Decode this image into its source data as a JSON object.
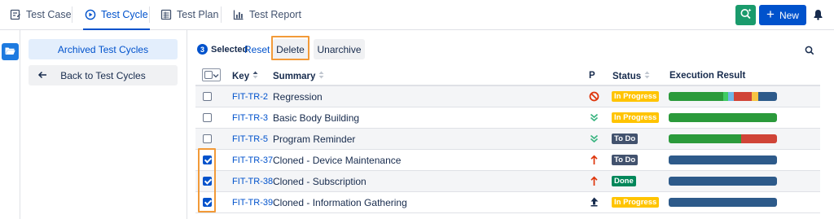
{
  "nav": {
    "tabs": [
      {
        "label": "Test Case",
        "icon": "test-case-icon"
      },
      {
        "label": "Test Cycle",
        "icon": "test-cycle-icon",
        "active": true
      },
      {
        "label": "Test Plan",
        "icon": "test-plan-icon"
      },
      {
        "label": "Test Report",
        "icon": "test-report-icon"
      }
    ],
    "new_label": "New",
    "ai_icon": "ai-search-icon",
    "bell_icon": "bell-icon"
  },
  "sidebar": {
    "archived_label": "Archived Test Cycles",
    "back_label": "Back to Test Cycles"
  },
  "toolbar": {
    "selected_count": "3",
    "selected_label": "Selected",
    "reset_label": "Reset",
    "delete_label": "Delete",
    "unarchive_label": "Unarchive"
  },
  "table": {
    "headers": {
      "key": "Key",
      "summary": "Summary",
      "priority": "P",
      "status": "Status",
      "execution": "Execution Result"
    },
    "rows": [
      {
        "key": "FIT-TR-2",
        "summary": "Regression",
        "priority": "blocker",
        "status": "In Progress",
        "checked": false,
        "execution": [
          {
            "color": "#2b9a3b",
            "pct": 50
          },
          {
            "color": "#3fcb64",
            "pct": 5
          },
          {
            "color": "#6fb6e6",
            "pct": 5
          },
          {
            "color": "#d04437",
            "pct": 17
          },
          {
            "color": "#f6c342",
            "pct": 6
          },
          {
            "color": "#2d5a8a",
            "pct": 17
          }
        ]
      },
      {
        "key": "FIT-TR-3",
        "summary": "Basic Body Building",
        "priority": "lowest",
        "status": "In Progress",
        "checked": false,
        "execution": [
          {
            "color": "#2b9a3b",
            "pct": 100
          }
        ]
      },
      {
        "key": "FIT-TR-5",
        "summary": "Program Reminder",
        "priority": "lowest",
        "status": "To Do",
        "checked": false,
        "execution": [
          {
            "color": "#2b9a3b",
            "pct": 67
          },
          {
            "color": "#d04437",
            "pct": 33
          }
        ]
      },
      {
        "key": "FIT-TR-37",
        "summary": "Cloned - Device Maintenance",
        "priority": "high",
        "status": "To Do",
        "checked": true,
        "execution": [
          {
            "color": "#2d5a8a",
            "pct": 100
          }
        ]
      },
      {
        "key": "FIT-TR-38",
        "summary": "Cloned - Subscription",
        "priority": "high",
        "status": "Done",
        "checked": true,
        "execution": [
          {
            "color": "#2d5a8a",
            "pct": 100
          }
        ]
      },
      {
        "key": "FIT-TR-39",
        "summary": "Cloned - Information Gathering",
        "priority": "highest",
        "status": "In Progress",
        "checked": true,
        "execution": [
          {
            "color": "#2d5a8a",
            "pct": 100
          }
        ]
      }
    ]
  },
  "colors": {
    "accent": "#0052cc",
    "highlight": "#f29a38",
    "in_progress": "#ffc400",
    "todo": "#42526e",
    "done": "#00875a"
  }
}
